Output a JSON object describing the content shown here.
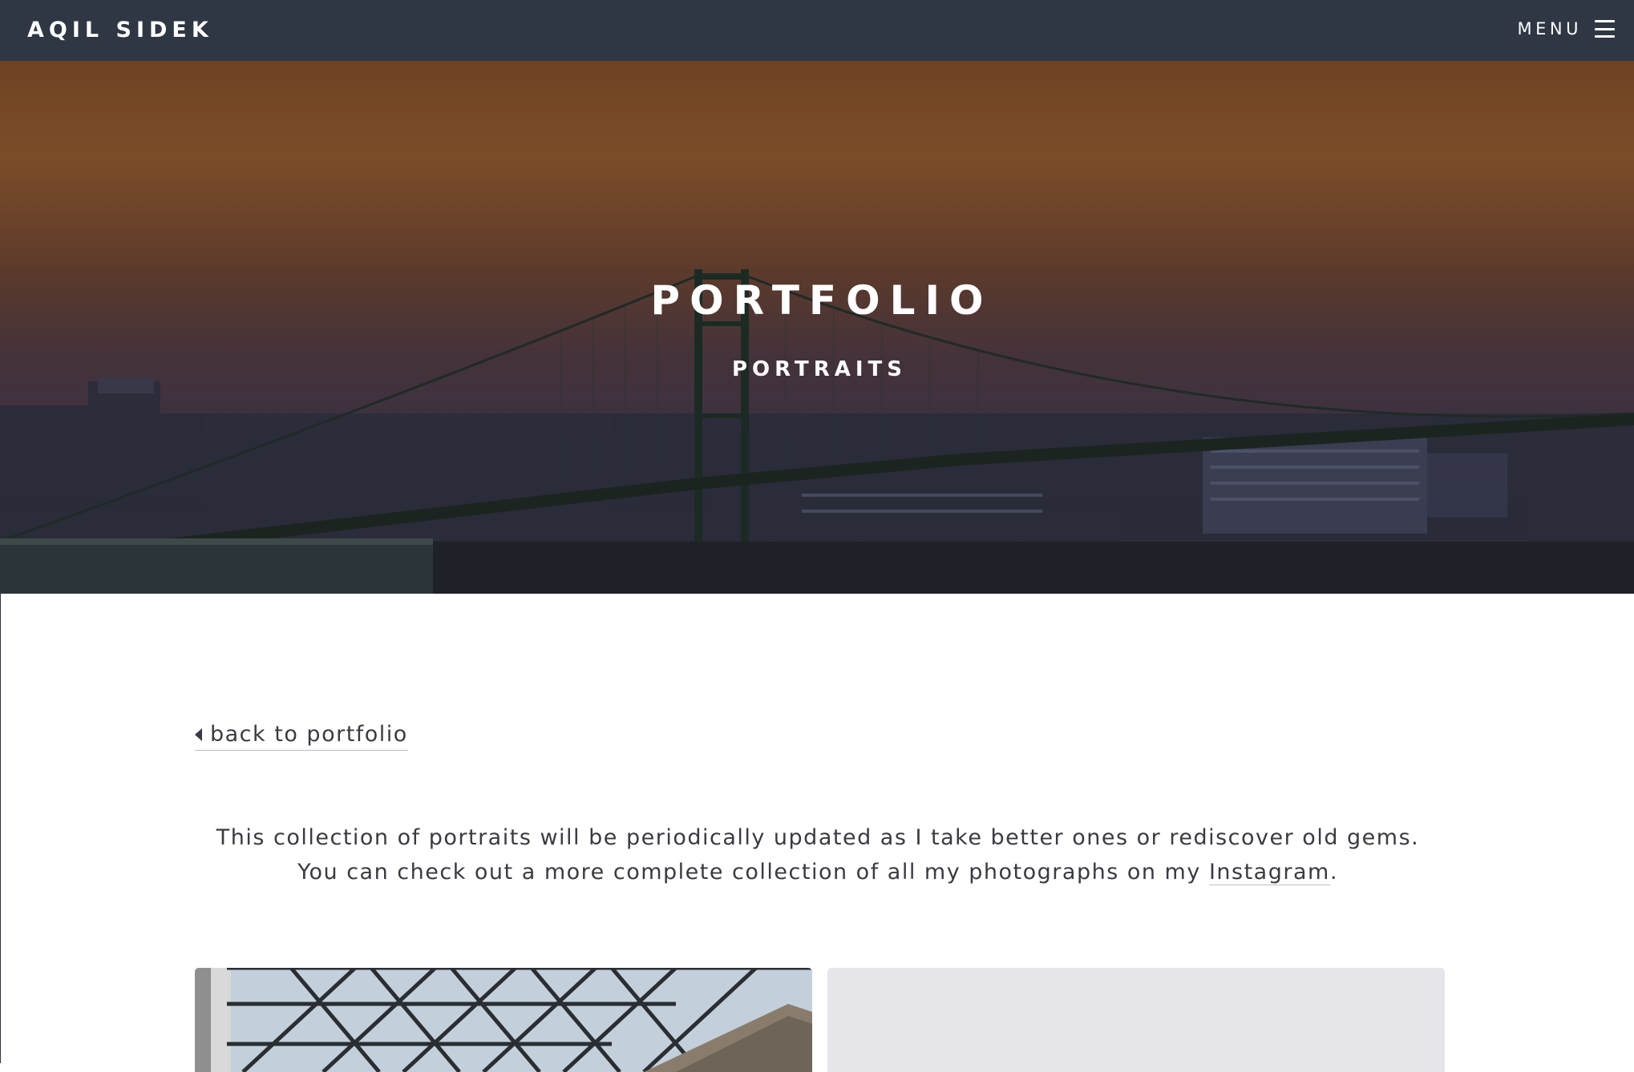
{
  "nav": {
    "brand": "AQIL SIDEK",
    "menu_label": "MENU"
  },
  "hero": {
    "title": "PORTFOLIO",
    "subtitle": "PORTRAITS",
    "background": "dusk suspension bridge over harbour skyline"
  },
  "content": {
    "back_link": "back to portfolio",
    "intro_line1": "This collection of portraits will be periodically updated as I take better ones or rediscover old gems.",
    "intro_line2_prefix": "You can check out a more complete collection of all my photographs on my ",
    "intro_link": "Instagram",
    "intro_line2_suffix": "."
  },
  "gallery": {
    "items": [
      {
        "alt": "glass roof architecture photo"
      },
      {
        "alt": "overcast sky photo"
      }
    ]
  },
  "colors": {
    "nav_bg": "#2e3743",
    "text": "#3a3a42",
    "hero_sky_top": "#7a4a26",
    "hero_sky_bottom": "#3d3142"
  }
}
